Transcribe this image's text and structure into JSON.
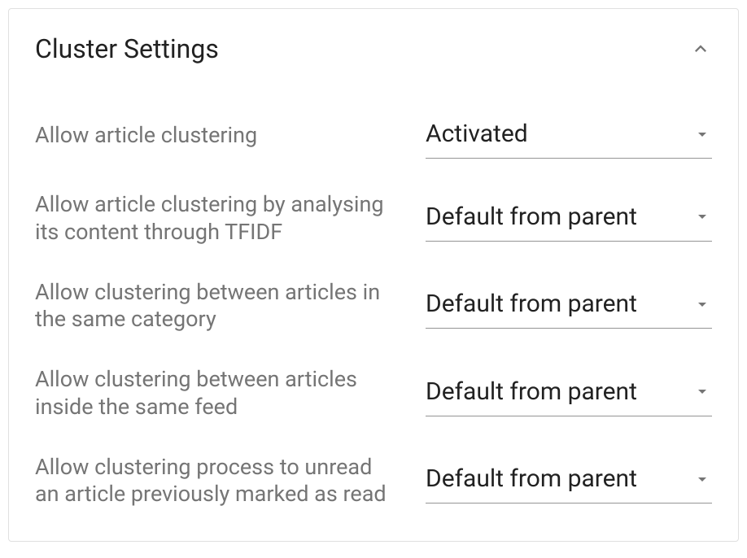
{
  "panel": {
    "title": "Cluster Settings",
    "settings": [
      {
        "label": "Allow article clustering",
        "value": "Activated"
      },
      {
        "label": "Allow article clustering by analysing its content through TFIDF",
        "value": "Default from parent"
      },
      {
        "label": "Allow clustering between articles in the same category",
        "value": "Default from parent"
      },
      {
        "label": "Allow clustering between articles inside the same feed",
        "value": "Default from parent"
      },
      {
        "label": "Allow clustering process to unread an article previously marked as read",
        "value": "Default from parent"
      }
    ]
  }
}
